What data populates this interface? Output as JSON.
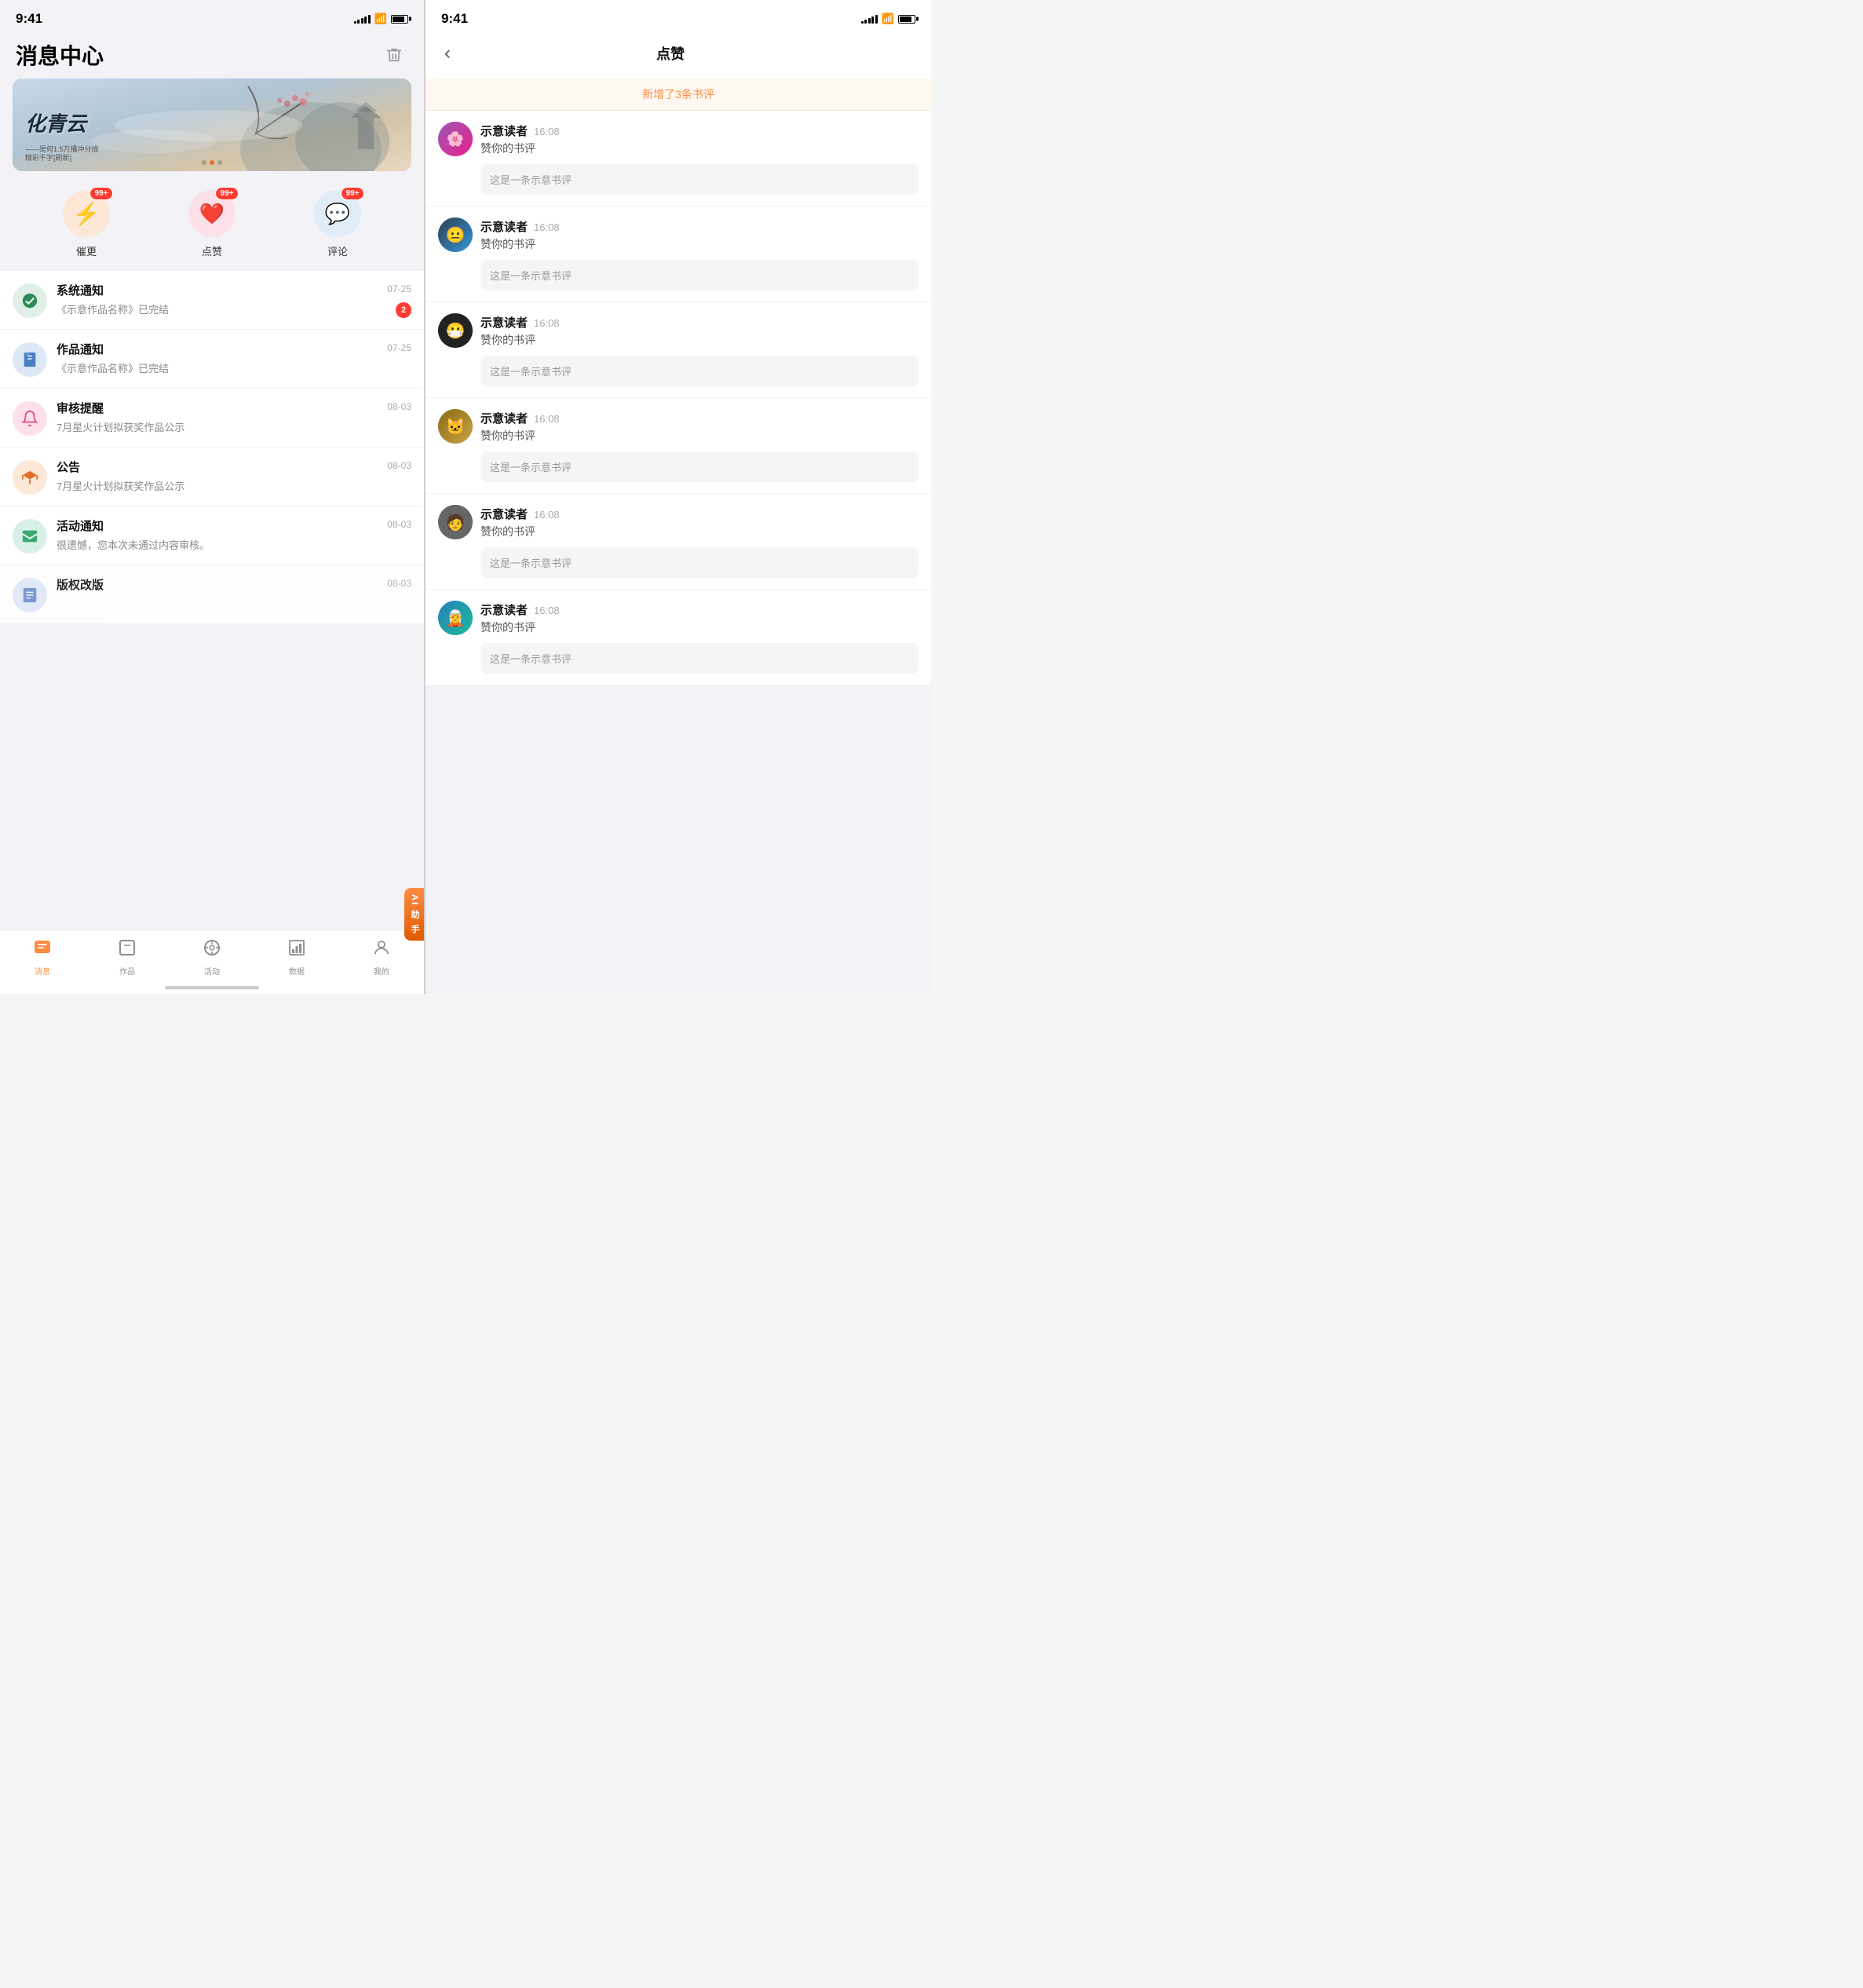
{
  "left": {
    "statusBar": {
      "time": "9:41",
      "signalBars": [
        3,
        6,
        9,
        12,
        15
      ],
      "wifi": "wifi",
      "battery": "battery"
    },
    "pageTitle": "消息中心",
    "trashIcon": "🗑",
    "banner": {
      "title": "化青云",
      "subtitle": "——是何1.5万播冲分成 精彩千字[刷新]",
      "dot1": "",
      "dot2": "",
      "dot3": ""
    },
    "categories": [
      {
        "id": "urge",
        "label": "催更",
        "icon": "⚡",
        "badge": "99+",
        "colorClass": "orange"
      },
      {
        "id": "like",
        "label": "点赞",
        "icon": "❤️",
        "badge": "99+",
        "colorClass": "pink"
      },
      {
        "id": "comment",
        "label": "评论",
        "icon": "💬",
        "badge": "99+",
        "colorClass": "blue"
      }
    ],
    "notifications": [
      {
        "id": "sys",
        "icon": "✔",
        "iconClass": "green",
        "title": "系统通知",
        "desc": "《示意作品名称》已完结",
        "date": "07-25",
        "unread": "2"
      },
      {
        "id": "work",
        "icon": "🔖",
        "iconClass": "blue",
        "title": "作品通知",
        "desc": "《示意作品名称》已完结",
        "date": "07-25",
        "unread": ""
      },
      {
        "id": "review",
        "icon": "🔔",
        "iconClass": "pink",
        "title": "审核提醒",
        "desc": "7月星火计划拟获奖作品公示",
        "date": "08-03",
        "unread": ""
      },
      {
        "id": "announce",
        "icon": "📢",
        "iconClass": "orange",
        "title": "公告",
        "desc": "7月星火计划拟获奖作品公示",
        "date": "08-03",
        "unread": ""
      },
      {
        "id": "activity",
        "icon": "✉",
        "iconClass": "teal",
        "title": "活动通知",
        "desc": "很遗憾，您本次未通过内容审核。",
        "date": "08-03",
        "unread": ""
      },
      {
        "id": "copyright",
        "icon": "📄",
        "iconClass": "blue",
        "title": "版权改版",
        "desc": "",
        "date": "08-03",
        "unread": ""
      }
    ],
    "aiBtn": "AI\n助\n手",
    "bottomNav": [
      {
        "id": "msg",
        "icon": "💬",
        "label": "消息",
        "active": true
      },
      {
        "id": "work",
        "icon": "□",
        "label": "作品",
        "active": false
      },
      {
        "id": "activity",
        "icon": "◎",
        "label": "活动",
        "active": false
      },
      {
        "id": "data",
        "icon": "📊",
        "label": "数据",
        "active": false
      },
      {
        "id": "mine",
        "icon": "😐",
        "label": "我的",
        "active": false
      }
    ]
  },
  "right": {
    "statusBar": {
      "time": "9:41"
    },
    "backLabel": "‹",
    "pageTitle": "点赞",
    "noticeBar": "新增了3条书评",
    "likeItems": [
      {
        "id": "user1",
        "username": "示意读者",
        "time": "16:08",
        "action": "赞你的书评",
        "preview": "这是一条示意书评",
        "avatarClass": "avatar-1",
        "avatarEmoji": ""
      },
      {
        "id": "user2",
        "username": "示意读者",
        "time": "16:08",
        "action": "赞你的书评",
        "preview": "这是一条示意书评",
        "avatarClass": "avatar-2",
        "avatarEmoji": ""
      },
      {
        "id": "user3",
        "username": "示意读者",
        "time": "16:08",
        "action": "赞你的书评",
        "preview": "这是一条示意书评",
        "avatarClass": "avatar-3",
        "avatarEmoji": "😷"
      },
      {
        "id": "user4",
        "username": "示意读者",
        "time": "16:08",
        "action": "赞你的书评",
        "preview": "这是一条示意书评",
        "avatarClass": "avatar-4",
        "avatarEmoji": "🐱"
      },
      {
        "id": "user5",
        "username": "示意读者",
        "time": "16:08",
        "action": "赞你的书评",
        "preview": "这是一条示意书评",
        "avatarClass": "avatar-5",
        "avatarEmoji": "🧑"
      },
      {
        "id": "user6",
        "username": "示意读者",
        "time": "16:08",
        "action": "赞你的书评",
        "preview": "这是一条示意书评",
        "avatarClass": "avatar-6",
        "avatarEmoji": "🧝"
      }
    ]
  }
}
